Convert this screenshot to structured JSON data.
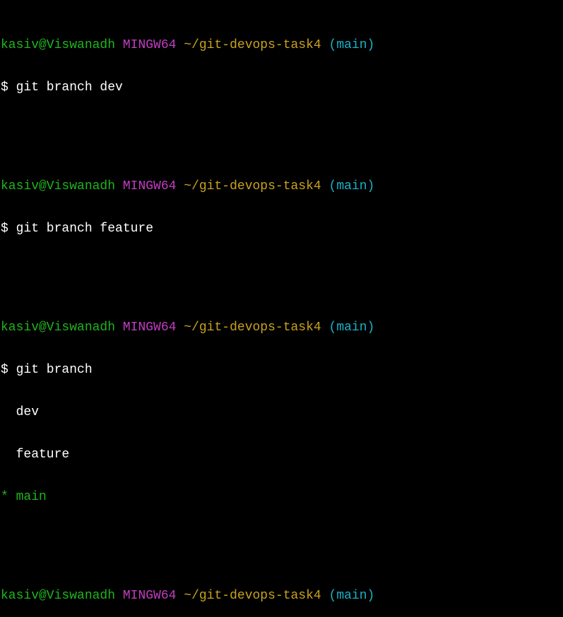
{
  "prompts": [
    {
      "user": "kasiv@Viswanadh",
      "system": "MINGW64",
      "path": "~/git-devops-task4",
      "branch": "(main)"
    },
    {
      "user": "kasiv@Viswanadh",
      "system": "MINGW64",
      "path": "~/git-devops-task4",
      "branch": "(main)"
    },
    {
      "user": "kasiv@Viswanadh",
      "system": "MINGW64",
      "path": "~/git-devops-task4",
      "branch": "(main)"
    },
    {
      "user": "kasiv@Viswanadh",
      "system": "MINGW64",
      "path": "~/git-devops-task4",
      "branch": "(main)"
    }
  ],
  "commands": [
    "$ git branch dev",
    "$ git branch feature",
    "$ git branch",
    "$"
  ],
  "branch_list": [
    "  dev",
    "  feature",
    "* main"
  ],
  "colors": {
    "background": "#000000",
    "user": "#1db61d",
    "system": "#c23cc2",
    "path": "#c8a31c",
    "branch": "#19b2c8",
    "text": "#ffffff"
  }
}
